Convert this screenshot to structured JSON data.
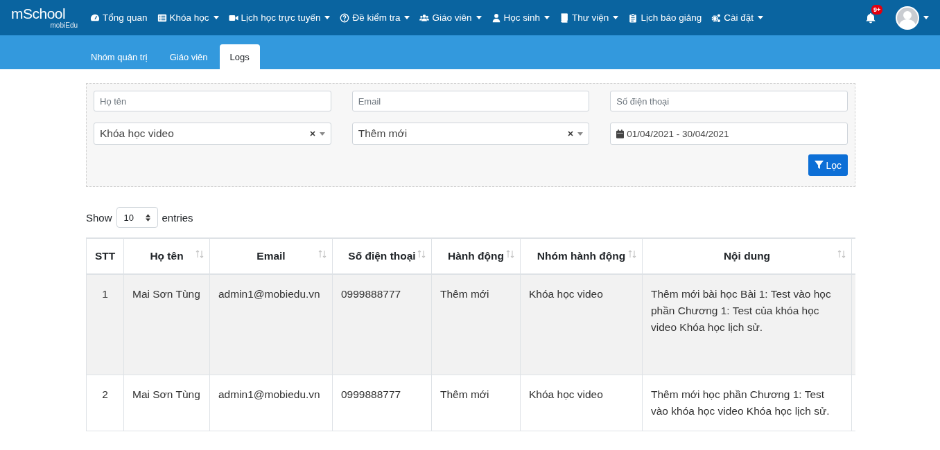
{
  "logo": {
    "text": "mSchool",
    "sub": "mobiEdu"
  },
  "nav": [
    {
      "label": "Tổng quan",
      "kind": "gauge",
      "dropdown": false
    },
    {
      "label": "Khóa học",
      "kind": "list",
      "dropdown": true
    },
    {
      "label": "Lịch học trực tuyến",
      "kind": "video",
      "dropdown": true
    },
    {
      "label": "Đề kiểm tra",
      "kind": "question",
      "dropdown": true
    },
    {
      "label": "Giáo viên",
      "kind": "users",
      "dropdown": true
    },
    {
      "label": "Học sinh",
      "kind": "user",
      "dropdown": true
    },
    {
      "label": "Thư viện",
      "kind": "book",
      "dropdown": true
    },
    {
      "label": "Lịch báo giảng",
      "kind": "clipboard",
      "dropdown": false
    },
    {
      "label": "Cài đặt",
      "kind": "gears",
      "dropdown": true
    }
  ],
  "notifications": {
    "badge": "9+"
  },
  "tabs": [
    {
      "label": "Nhóm quản trị",
      "selected": false
    },
    {
      "label": "Giáo viên",
      "selected": false
    },
    {
      "label": "Logs",
      "selected": true
    }
  ],
  "filters": {
    "name": {
      "placeholder": "Họ tên"
    },
    "email": {
      "placeholder": "Email"
    },
    "phone": {
      "placeholder": "Số điện thoại"
    },
    "course_type": {
      "value": "Khóa học video"
    },
    "action": {
      "value": "Thêm mới"
    },
    "date_range": {
      "value": "01/04/2021 - 30/04/2021"
    },
    "filter_button": "Lọc"
  },
  "length": {
    "before": "Show",
    "value": "10",
    "after": "entries"
  },
  "table": {
    "columns": [
      {
        "label": "STT",
        "sortable": false
      },
      {
        "label": "Họ tên",
        "sortable": true
      },
      {
        "label": "Email",
        "sortable": true
      },
      {
        "label": "Số điện thoại",
        "sortable": true
      },
      {
        "label": "Hành động",
        "sortable": true
      },
      {
        "label": "Nhóm hành động",
        "sortable": true
      },
      {
        "label": "Nội dung",
        "sortable": true
      }
    ],
    "rows": [
      [
        "1",
        "Mai Sơn Tùng",
        "admin1@mobiedu.vn",
        "0999888777",
        "Thêm mới",
        "Khóa học video",
        "Thêm mới bài học Bài 1: Test vào học phần Chương 1: Test của khóa học video Khóa học lịch sử."
      ],
      [
        "2",
        "Mai Sơn Tùng",
        "admin1@mobiedu.vn",
        "0999888777",
        "Thêm mới",
        "Khóa học video",
        "Thêm mới học phần Chương 1: Test vào khóa học video Khóa học lịch sử."
      ]
    ]
  }
}
